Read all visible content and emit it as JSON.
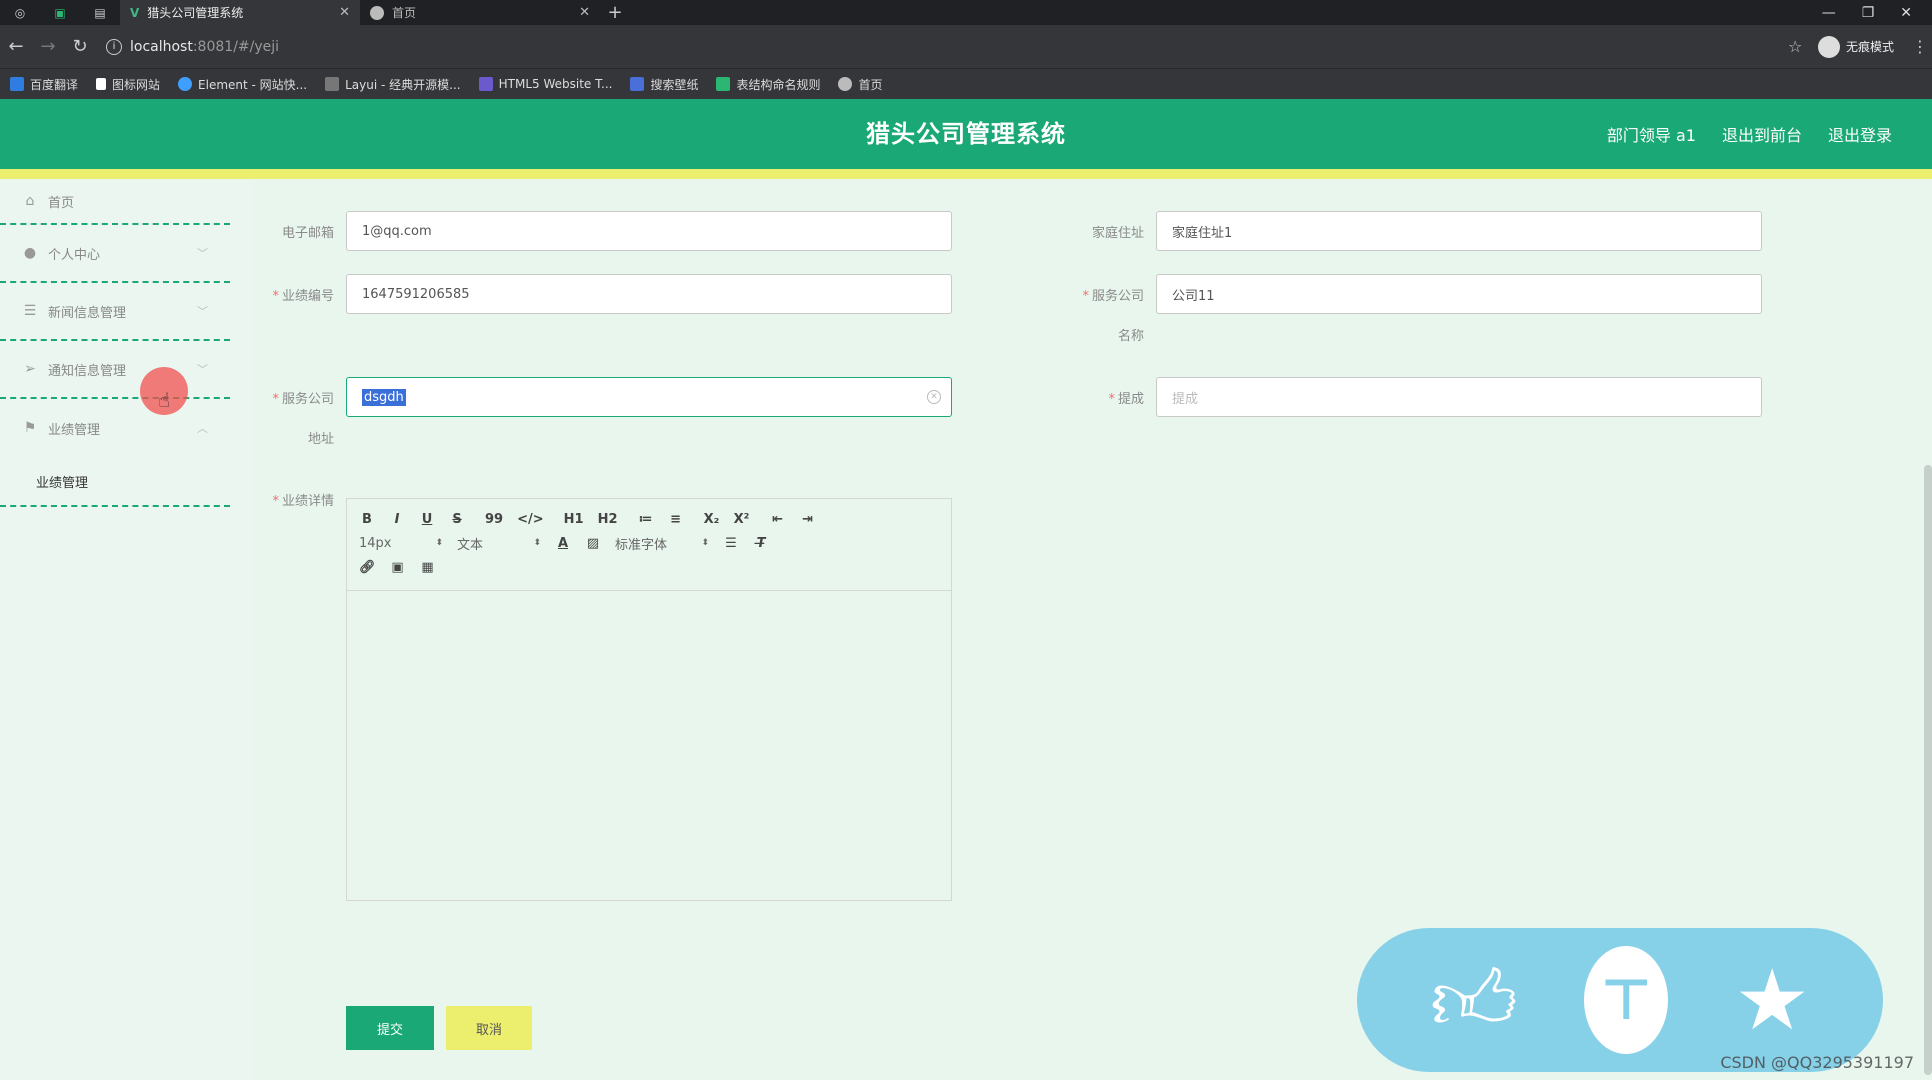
{
  "browser": {
    "tabs": [
      {
        "title": "猎头公司管理系统",
        "active": true
      },
      {
        "title": "首页",
        "active": false
      }
    ],
    "url_host": "localhost",
    "url_path": ":8081/#/yeji",
    "profile": "无痕模式",
    "bookmarks": [
      {
        "label": "百度翻译",
        "color": "#2f7de1"
      },
      {
        "label": "图标网站",
        "color": "#ffffff"
      },
      {
        "label": "Element - 网站快...",
        "color": "#409eff"
      },
      {
        "label": "Layui - 经典开源模...",
        "color": "#aaaaaa"
      },
      {
        "label": "HTML5 Website T...",
        "color": "#6a5acd"
      },
      {
        "label": "搜索壁纸",
        "color": "#4a6fd8"
      },
      {
        "label": "表结构命名规则",
        "color": "#2cb673"
      },
      {
        "label": "首页",
        "color": "#bbbbbb"
      }
    ]
  },
  "header": {
    "title": "猎头公司管理系统",
    "user": "部门领导 a1",
    "exit_front": "退出到前台",
    "logout": "退出登录",
    "bg_color": "#1aa876",
    "accent_yellow": "#ecee6e"
  },
  "sidebar": {
    "items": [
      {
        "label": "首页",
        "icon": "home-icon"
      },
      {
        "label": "个人中心",
        "icon": "user-icon"
      },
      {
        "label": "新闻信息管理",
        "icon": "sliders-icon"
      },
      {
        "label": "通知信息管理",
        "icon": "send-icon"
      },
      {
        "label": "业绩管理",
        "icon": "flag-icon"
      }
    ],
    "sub_item": "业绩管理"
  },
  "form": {
    "email_label": "电子邮箱",
    "email_value": "1@qq.com",
    "address_label": "家庭住址",
    "address_value": "家庭住址1",
    "perf_no_label": "业绩编号",
    "perf_no_value": "1647591206585",
    "company_name_label_1": "服务公司",
    "company_name_label_2": "名称",
    "company_name_value": "公司11",
    "company_addr_label_1": "服务公司",
    "company_addr_label_2": "地址",
    "company_addr_value": "dsgdh",
    "commission_label": "提成",
    "commission_placeholder": "提成",
    "detail_label": "业绩详情",
    "required_mark": "*"
  },
  "editor": {
    "row1": [
      "B",
      "I",
      "U",
      "S",
      "99",
      "</>",
      "H1",
      "H2",
      "≔",
      "≡",
      "X₂",
      "X²",
      "⇤",
      "⇥"
    ],
    "font_size": "14px",
    "text_type": "文本",
    "font_family": "标准字体",
    "row3_icons": [
      "link-icon",
      "image-icon",
      "video-icon"
    ]
  },
  "buttons": {
    "submit": "提交",
    "cancel": "取消"
  },
  "watermark": "CSDN @QQ3295391197"
}
